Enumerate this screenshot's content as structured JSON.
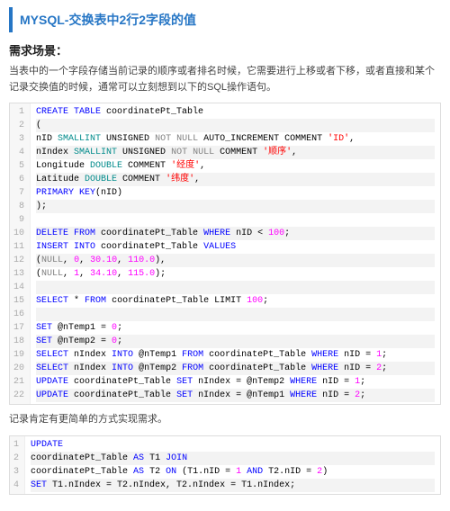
{
  "header": {
    "title": "MYSQL-交换表中2行2字段的值"
  },
  "section1": {
    "heading": "需求场景：",
    "desc": "当表中的一个字段存储当前记录的顺序或者排名时候，它需要进行上移或者下移，或者直接和某个记录交换值的时候，通常可以立刻想到以下的SQL操作语句。"
  },
  "code1": {
    "lines": [
      [
        [
          "kw-blue",
          "CREATE TABLE"
        ],
        [
          "txt",
          " coordinatePt_Table"
        ]
      ],
      [
        [
          "txt",
          "("
        ]
      ],
      [
        [
          "txt",
          "nID "
        ],
        [
          "kw-teal",
          "SMALLINT"
        ],
        [
          "txt",
          " UNSIGNED "
        ],
        [
          "kw-gray",
          "NOT NULL"
        ],
        [
          "txt",
          " AUTO_INCREMENT COMMENT "
        ],
        [
          "str",
          "'ID'"
        ],
        [
          "txt",
          ","
        ]
      ],
      [
        [
          "txt",
          "nIndex "
        ],
        [
          "kw-teal",
          "SMALLINT"
        ],
        [
          "txt",
          " UNSIGNED "
        ],
        [
          "kw-gray",
          "NOT NULL"
        ],
        [
          "txt",
          " COMMENT "
        ],
        [
          "str",
          "'顺序'"
        ],
        [
          "txt",
          ","
        ]
      ],
      [
        [
          "txt",
          "Longitude "
        ],
        [
          "kw-teal",
          "DOUBLE"
        ],
        [
          "txt",
          " COMMENT "
        ],
        [
          "str",
          "'经度'"
        ],
        [
          "txt",
          ","
        ]
      ],
      [
        [
          "txt",
          "Latitude "
        ],
        [
          "kw-teal",
          "DOUBLE"
        ],
        [
          "txt",
          " COMMENT "
        ],
        [
          "str",
          "'纬度'"
        ],
        [
          "txt",
          ","
        ]
      ],
      [
        [
          "kw-blue",
          "PRIMARY KEY"
        ],
        [
          "txt",
          "(nID)"
        ]
      ],
      [
        [
          "txt",
          ");"
        ]
      ],
      [
        [
          "txt",
          ""
        ]
      ],
      [
        [
          "kw-blue",
          "DELETE FROM"
        ],
        [
          "txt",
          " coordinatePt_Table "
        ],
        [
          "kw-blue",
          "WHERE"
        ],
        [
          "txt",
          " nID < "
        ],
        [
          "num",
          "100"
        ],
        [
          "txt",
          ";"
        ]
      ],
      [
        [
          "kw-blue",
          "INSERT INTO"
        ],
        [
          "txt",
          " coordinatePt_Table "
        ],
        [
          "kw-blue",
          "VALUES"
        ]
      ],
      [
        [
          "txt",
          "("
        ],
        [
          "kw-gray",
          "NULL"
        ],
        [
          "txt",
          ", "
        ],
        [
          "num",
          "0"
        ],
        [
          "txt",
          ", "
        ],
        [
          "num",
          "30.10"
        ],
        [
          "txt",
          ", "
        ],
        [
          "num",
          "110.0"
        ],
        [
          "txt",
          "),"
        ]
      ],
      [
        [
          "txt",
          "("
        ],
        [
          "kw-gray",
          "NULL"
        ],
        [
          "txt",
          ", "
        ],
        [
          "num",
          "1"
        ],
        [
          "txt",
          ", "
        ],
        [
          "num",
          "34.10"
        ],
        [
          "txt",
          ", "
        ],
        [
          "num",
          "115.0"
        ],
        [
          "txt",
          ");"
        ]
      ],
      [
        [
          "txt",
          ""
        ]
      ],
      [
        [
          "kw-blue",
          "SELECT"
        ],
        [
          "txt",
          " * "
        ],
        [
          "kw-blue",
          "FROM"
        ],
        [
          "txt",
          " coordinatePt_Table LIMIT "
        ],
        [
          "num",
          "100"
        ],
        [
          "txt",
          ";"
        ]
      ],
      [
        [
          "txt",
          ""
        ]
      ],
      [
        [
          "kw-blue",
          "SET"
        ],
        [
          "txt",
          " @nTemp1 = "
        ],
        [
          "num",
          "0"
        ],
        [
          "txt",
          ";"
        ]
      ],
      [
        [
          "kw-blue",
          "SET"
        ],
        [
          "txt",
          " @nTemp2 = "
        ],
        [
          "num",
          "0"
        ],
        [
          "txt",
          ";"
        ]
      ],
      [
        [
          "kw-blue",
          "SELECT"
        ],
        [
          "txt",
          " nIndex "
        ],
        [
          "kw-blue",
          "INTO"
        ],
        [
          "txt",
          " @nTemp1 "
        ],
        [
          "kw-blue",
          "FROM"
        ],
        [
          "txt",
          " coordinatePt_Table "
        ],
        [
          "kw-blue",
          "WHERE"
        ],
        [
          "txt",
          " nID = "
        ],
        [
          "num",
          "1"
        ],
        [
          "txt",
          ";"
        ]
      ],
      [
        [
          "kw-blue",
          "SELECT"
        ],
        [
          "txt",
          " nIndex "
        ],
        [
          "kw-blue",
          "INTO"
        ],
        [
          "txt",
          " @nTemp2 "
        ],
        [
          "kw-blue",
          "FROM"
        ],
        [
          "txt",
          " coordinatePt_Table "
        ],
        [
          "kw-blue",
          "WHERE"
        ],
        [
          "txt",
          " nID = "
        ],
        [
          "num",
          "2"
        ],
        [
          "txt",
          ";"
        ]
      ],
      [
        [
          "kw-blue",
          "UPDATE"
        ],
        [
          "txt",
          " coordinatePt_Table "
        ],
        [
          "kw-blue",
          "SET"
        ],
        [
          "txt",
          " nIndex = @nTemp2 "
        ],
        [
          "kw-blue",
          "WHERE"
        ],
        [
          "txt",
          " nID = "
        ],
        [
          "num",
          "1"
        ],
        [
          "txt",
          ";"
        ]
      ],
      [
        [
          "kw-blue",
          "UPDATE"
        ],
        [
          "txt",
          " coordinatePt_Table "
        ],
        [
          "kw-blue",
          "SET"
        ],
        [
          "txt",
          " nIndex = @nTemp1 "
        ],
        [
          "kw-blue",
          "WHERE"
        ],
        [
          "txt",
          " nID = "
        ],
        [
          "num",
          "2"
        ],
        [
          "txt",
          ";"
        ]
      ]
    ]
  },
  "note": {
    "text": "记录肯定有更简单的方式实现需求。"
  },
  "code2": {
    "lines": [
      [
        [
          "kw-blue",
          "UPDATE"
        ]
      ],
      [
        [
          "txt",
          "coordinatePt_Table "
        ],
        [
          "kw-blue",
          "AS"
        ],
        [
          "txt",
          " T1 "
        ],
        [
          "kw-blue",
          "JOIN"
        ]
      ],
      [
        [
          "txt",
          "coordinatePt_Table "
        ],
        [
          "kw-blue",
          "AS"
        ],
        [
          "txt",
          " T2 "
        ],
        [
          "kw-blue",
          "ON"
        ],
        [
          "txt",
          " (T1.nID = "
        ],
        [
          "num",
          "1"
        ],
        [
          "txt",
          " "
        ],
        [
          "kw-blue",
          "AND"
        ],
        [
          "txt",
          " T2.nID = "
        ],
        [
          "num",
          "2"
        ],
        [
          "txt",
          ")"
        ]
      ],
      [
        [
          "kw-blue",
          "SET"
        ],
        [
          "txt",
          " T1.nIndex = T2.nIndex, T2.nIndex = T1.nIndex;"
        ]
      ]
    ]
  }
}
